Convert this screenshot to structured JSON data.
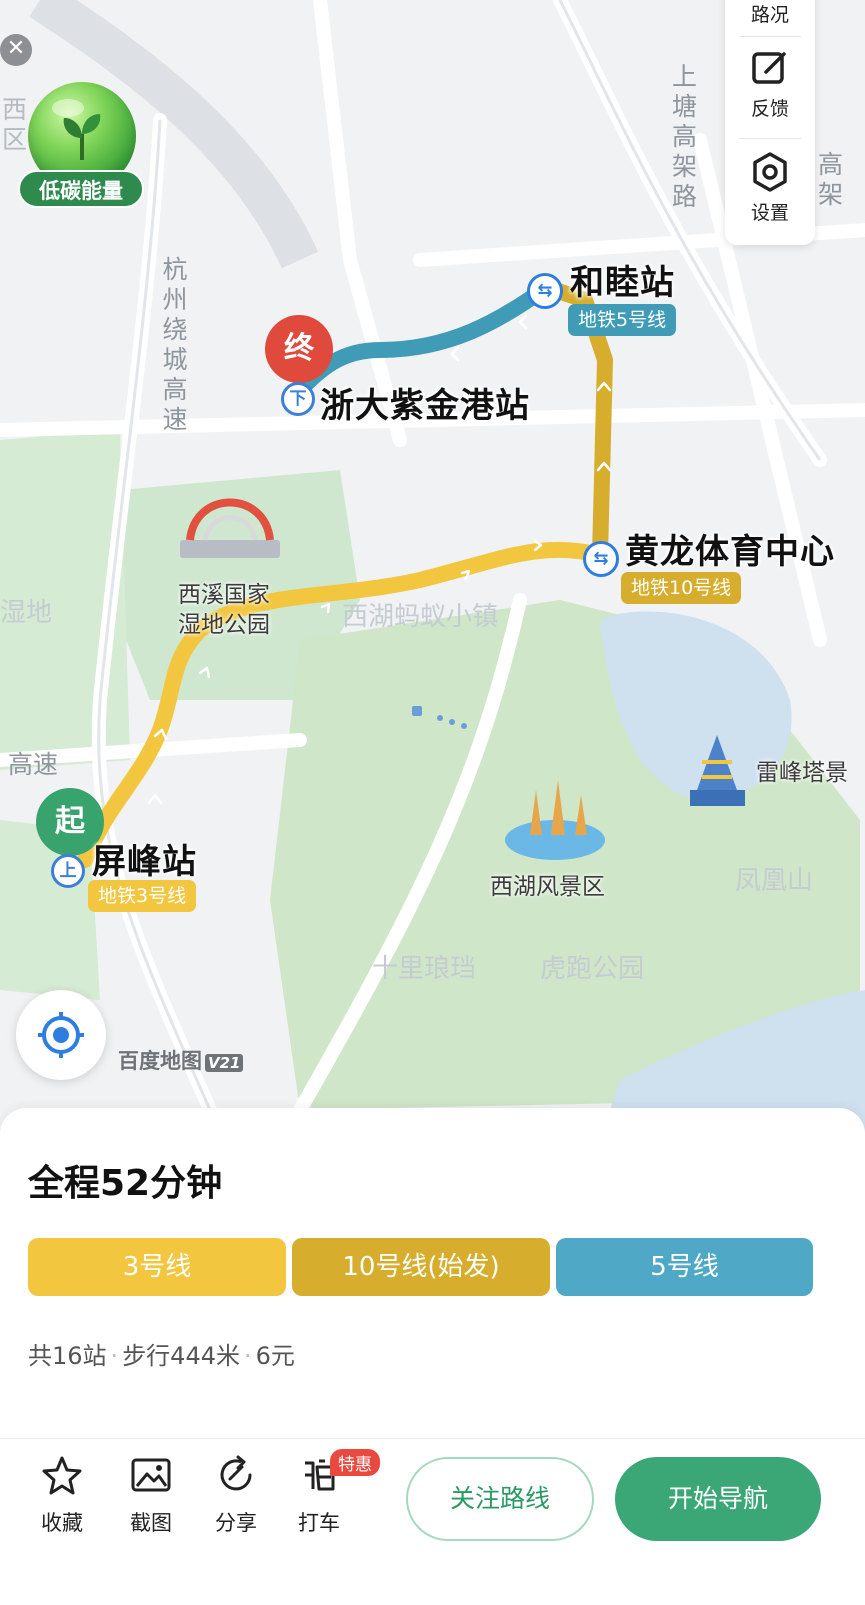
{
  "map": {
    "start_pin": "起",
    "end_pin": "终",
    "origin_station": "屏峰站",
    "destination_station": "浙大紫金港站",
    "transfer_stations": [
      {
        "name": "和睦站",
        "line": "地铁5号线"
      },
      {
        "name": "黄龙体育中心",
        "line": "地铁10号线"
      }
    ],
    "origin_line": "地铁3号线",
    "board_marker": "上",
    "alight_marker": "下",
    "pois": {
      "xixi": "西溪国家\n湿地公园",
      "westlake_scenic": "西湖风景区",
      "leifeng": "雷峰塔景",
      "antcity": "西湖蚂蚁小镇",
      "phoenix": "凤凰山",
      "shili": "十里琅珰",
      "hupao": "虎跑公园",
      "wetland_edge": "湿地"
    },
    "roads": {
      "ring": "杭\n州\n绕\n城\n高\n速",
      "elevated": "上\n塘\n高\n架\n路",
      "highway_left": "高速",
      "right_edge": "高\n架"
    },
    "edge_text": "西\n区",
    "watermark": "百度地图",
    "watermark_version": "V21"
  },
  "eco": {
    "label": "低碳能量"
  },
  "tools": [
    {
      "label": "路况",
      "icon": "traffic-icon"
    },
    {
      "label": "反馈",
      "icon": "feedback-icon"
    },
    {
      "label": "设置",
      "icon": "settings-icon"
    }
  ],
  "route": {
    "total": "全程52分钟",
    "segments": [
      {
        "label": "3号线",
        "color": "#f2c63f"
      },
      {
        "label": "10号线(始发)",
        "color": "#d6ad2c"
      },
      {
        "label": "5号线",
        "color": "#4fa8c6"
      }
    ],
    "stops": "共16站",
    "walk": "步行444米",
    "fare": "6元"
  },
  "bottom": {
    "favorite": "收藏",
    "screenshot": "截图",
    "share": "分享",
    "taxi": "打车",
    "promo": "特惠",
    "follow": "关注路线",
    "navigate": "开始导航"
  },
  "colors": {
    "line3": "#f2c63f",
    "line10": "#d6ad2c",
    "line5": "#3f9bb6",
    "accent_green": "#3ba776"
  }
}
